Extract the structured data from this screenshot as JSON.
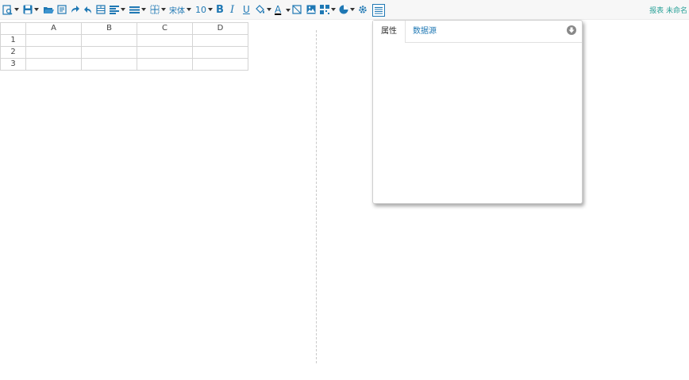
{
  "toolbar": {
    "icons": [
      "preview-icon",
      "save-icon",
      "open-folder-icon",
      "export-icon",
      "redo-icon",
      "undo-icon",
      "merge-cells-icon",
      "align-left-icon",
      "line-style-icon",
      "border-icon",
      "font-family",
      "font-size",
      "bold-icon",
      "italic-icon",
      "underline-icon",
      "fill-color-icon",
      "font-color-icon",
      "diagonal-icon",
      "image-icon",
      "barcode-icon",
      "chart-icon",
      "settings-icon",
      "form-icon"
    ],
    "font_family": "宋体",
    "font_size": "10",
    "bold_label": "B",
    "italic_label": "I",
    "underline_label": "U",
    "font_color_label": "A",
    "accent_color": "#1f78b4"
  },
  "document": {
    "name": "报表 未命名"
  },
  "grid": {
    "columns": [
      "A",
      "B",
      "C",
      "D"
    ],
    "rows": [
      "1",
      "2",
      "3"
    ]
  },
  "panel": {
    "tabs": [
      {
        "label": "属性"
      },
      {
        "label": "数据源"
      }
    ]
  }
}
